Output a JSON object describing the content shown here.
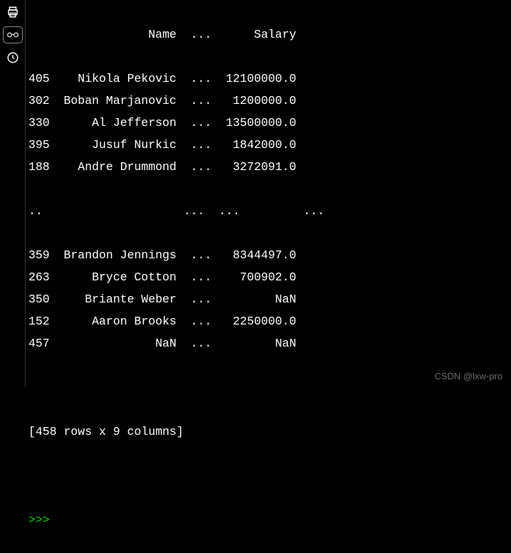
{
  "sidebar": {
    "icons": [
      "print-icon",
      "glasses-icon",
      "history-icon"
    ],
    "active_index": 1
  },
  "header_line": "                 Name  ...      Salary",
  "rows": [
    {
      "idx": "405",
      "name": "Nikola Pekovic",
      "salary": "12100000.0"
    },
    {
      "idx": "302",
      "name": "Boban Marjanovic",
      "salary": "1200000.0"
    },
    {
      "idx": "330",
      "name": "Al Jefferson",
      "salary": "13500000.0"
    },
    {
      "idx": "395",
      "name": "Jusuf Nurkic",
      "salary": "1842000.0"
    },
    {
      "idx": "188",
      "name": "Andre Drummond",
      "salary": "3272091.0"
    }
  ],
  "ellipsis_line": "..                    ...  ...         ...",
  "rows2": [
    {
      "idx": "359",
      "name": "Brandon Jennings",
      "salary": "8344497.0"
    },
    {
      "idx": "263",
      "name": "Bryce Cotton",
      "salary": "700902.0"
    },
    {
      "idx": "350",
      "name": "Briante Weber",
      "salary": "NaN"
    },
    {
      "idx": "152",
      "name": "Aaron Brooks",
      "salary": "2250000.0"
    },
    {
      "idx": "457",
      "name": "NaN",
      "salary": "NaN"
    }
  ],
  "summary": "[458 rows x 9 columns]",
  "prompt": ">>> ",
  "watermark": "CSDN @lxw-pro",
  "middle_sep": "  ...  "
}
